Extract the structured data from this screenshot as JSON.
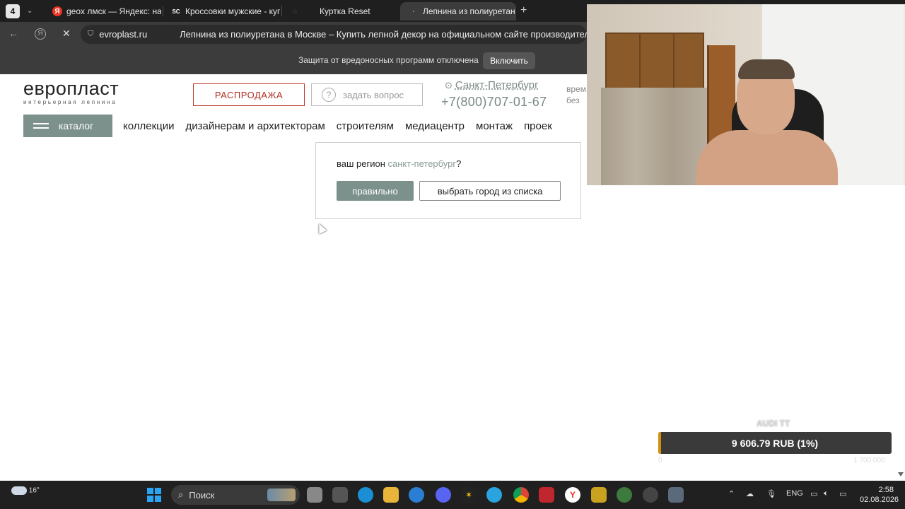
{
  "browser": {
    "tab_count": "4",
    "tabs": [
      {
        "favicon": "Я",
        "label": "geox лмск — Яндекс: наш"
      },
      {
        "favicon": "SC",
        "label": "Кроссовки мужские - куп"
      },
      {
        "favicon": "",
        "label": "Куртка Reset"
      },
      {
        "favicon": "",
        "label": "Лепнина из полиуретан"
      }
    ],
    "url_host": "evroplast.ru",
    "page_title": "Лепнина из полиуретана в Москве – Купить лепной декор на официальном сайте производителя",
    "protection_text": "Защита от вредоносных программ отключена",
    "protection_button": "Включить"
  },
  "site": {
    "logo": "европласт",
    "logo_sub": "интерьерная лепнина",
    "sale_button": "РАСПРОДАЖА",
    "ask_button": "задать вопрос",
    "city": "Санкт-Петербург",
    "phone": "+7(800)707-01-67",
    "hours_line1": "врем",
    "hours_line2": "без",
    "catalog_button": "каталог",
    "menu": [
      "коллекции",
      "дизайнерам и архитекторам",
      "строителям",
      "медиацентр",
      "монтаж",
      "проек"
    ]
  },
  "region_popup": {
    "question_prefix": "ваш регион ",
    "region": "санкт-петербург",
    "question_suffix": "?",
    "confirm_button": "правильно",
    "choose_button": "выбрать город из списка"
  },
  "donation": {
    "title": "AUDI TT",
    "amount_text": "9 606.79 RUB (1%)",
    "progress_fraction": 0.01,
    "min": "0",
    "max": "1 700 000"
  },
  "taskbar": {
    "temperature": "16°",
    "search_placeholder": "Поиск",
    "language": "ENG",
    "time": "2:58",
    "date": "02.08.2026"
  },
  "colors": {
    "accent": "#7c918c",
    "sale": "#b03024",
    "browser_dark": "#3c3c3c"
  }
}
